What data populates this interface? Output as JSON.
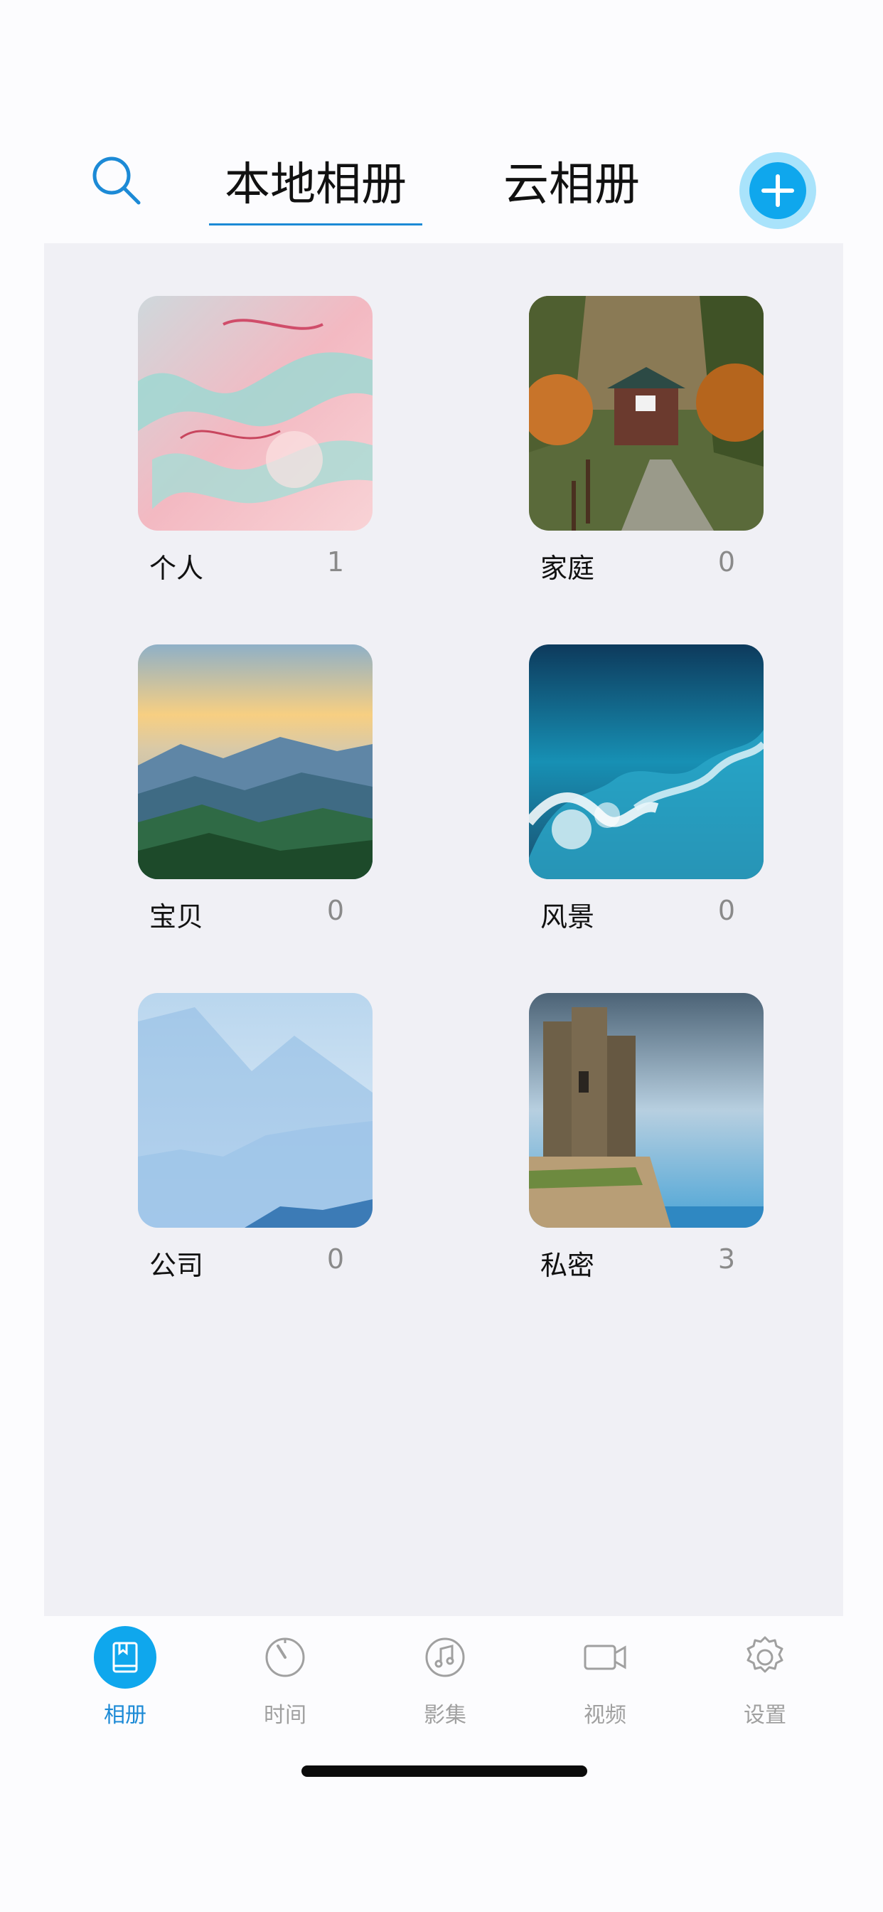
{
  "header": {
    "search_icon": "search-icon",
    "tabs": [
      {
        "label": "本地相册",
        "active": true
      },
      {
        "label": "云相册",
        "active": false
      }
    ],
    "add_icon": "plus-icon",
    "accent_color": "#0fa7ed"
  },
  "albums": [
    {
      "name": "个人",
      "count": "1"
    },
    {
      "name": "家庭",
      "count": "0"
    },
    {
      "name": "宝贝",
      "count": "0"
    },
    {
      "name": "风景",
      "count": "0"
    },
    {
      "name": "公司",
      "count": "0"
    },
    {
      "name": "私密",
      "count": "3"
    }
  ],
  "tabbar": {
    "items": [
      {
        "label": "相册",
        "icon": "album-book-icon",
        "active": true
      },
      {
        "label": "时间",
        "icon": "timer-icon",
        "active": false
      },
      {
        "label": "影集",
        "icon": "music-note-icon",
        "active": false
      },
      {
        "label": "视频",
        "icon": "video-camera-icon",
        "active": false
      },
      {
        "label": "设置",
        "icon": "gear-icon",
        "active": false
      }
    ]
  }
}
